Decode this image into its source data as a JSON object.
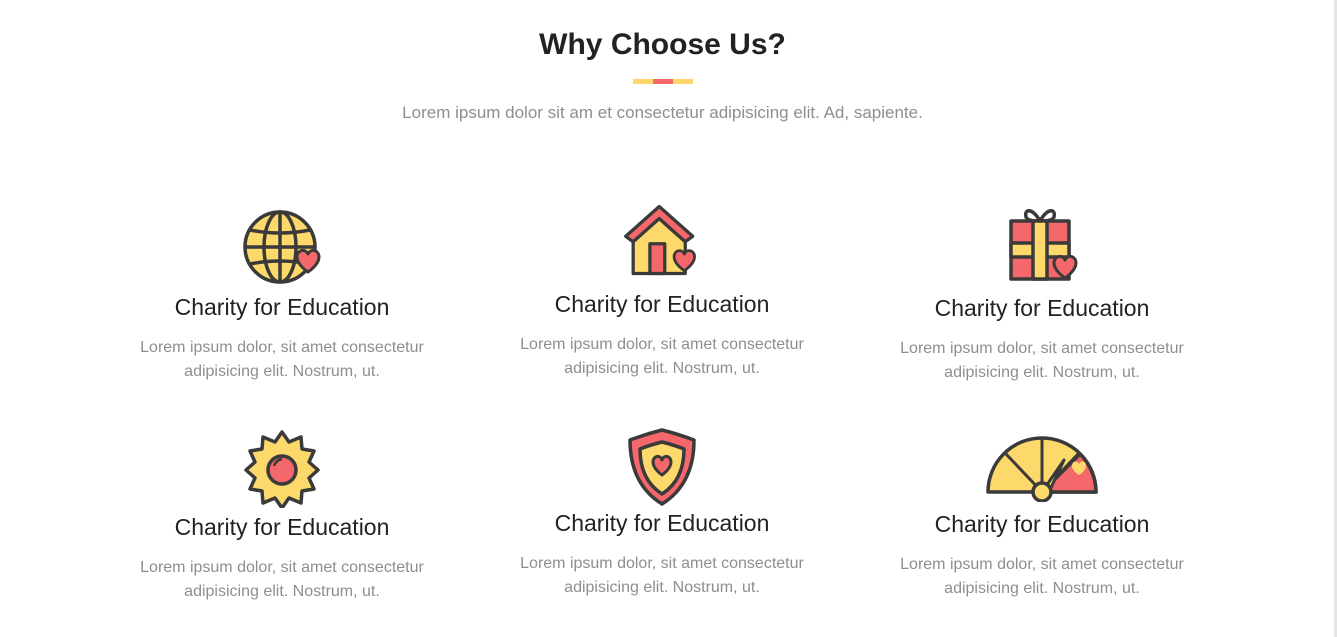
{
  "section": {
    "title": "Why Choose Us?",
    "subtitle": "Lorem ipsum dolor sit am et consectetur adipisicing elit. Ad, sapiente.",
    "divider_colors": [
      "#fcd86c",
      "#f4676b",
      "#fcd86c"
    ]
  },
  "colors": {
    "yellow": "#fdd96c",
    "red": "#f4676b",
    "outline": "#3a3a3a"
  },
  "features": [
    {
      "icon": "globe-heart-icon",
      "title": "Charity for Education",
      "text": "Lorem ipsum dolor, sit amet consectetur adipisicing elit. Nostrum, ut."
    },
    {
      "icon": "house-heart-icon",
      "title": "Charity for Education",
      "text": "Lorem ipsum dolor, sit amet consectetur adipisicing elit. Nostrum, ut."
    },
    {
      "icon": "gift-heart-icon",
      "title": "Charity for Education",
      "text": "Lorem ipsum dolor, sit amet consectetur adipisicing elit. Nostrum, ut."
    },
    {
      "icon": "flower-icon",
      "title": "Charity for Education",
      "text": "Lorem ipsum dolor, sit amet consectetur adipisicing elit. Nostrum, ut."
    },
    {
      "icon": "shield-heart-icon",
      "title": "Charity for Education",
      "text": "Lorem ipsum dolor, sit amet consectetur adipisicing elit. Nostrum, ut."
    },
    {
      "icon": "gauge-heart-icon",
      "title": "Charity for Education",
      "text": "Lorem ipsum dolor, sit amet consectetur adipisicing elit. Nostrum, ut."
    }
  ]
}
